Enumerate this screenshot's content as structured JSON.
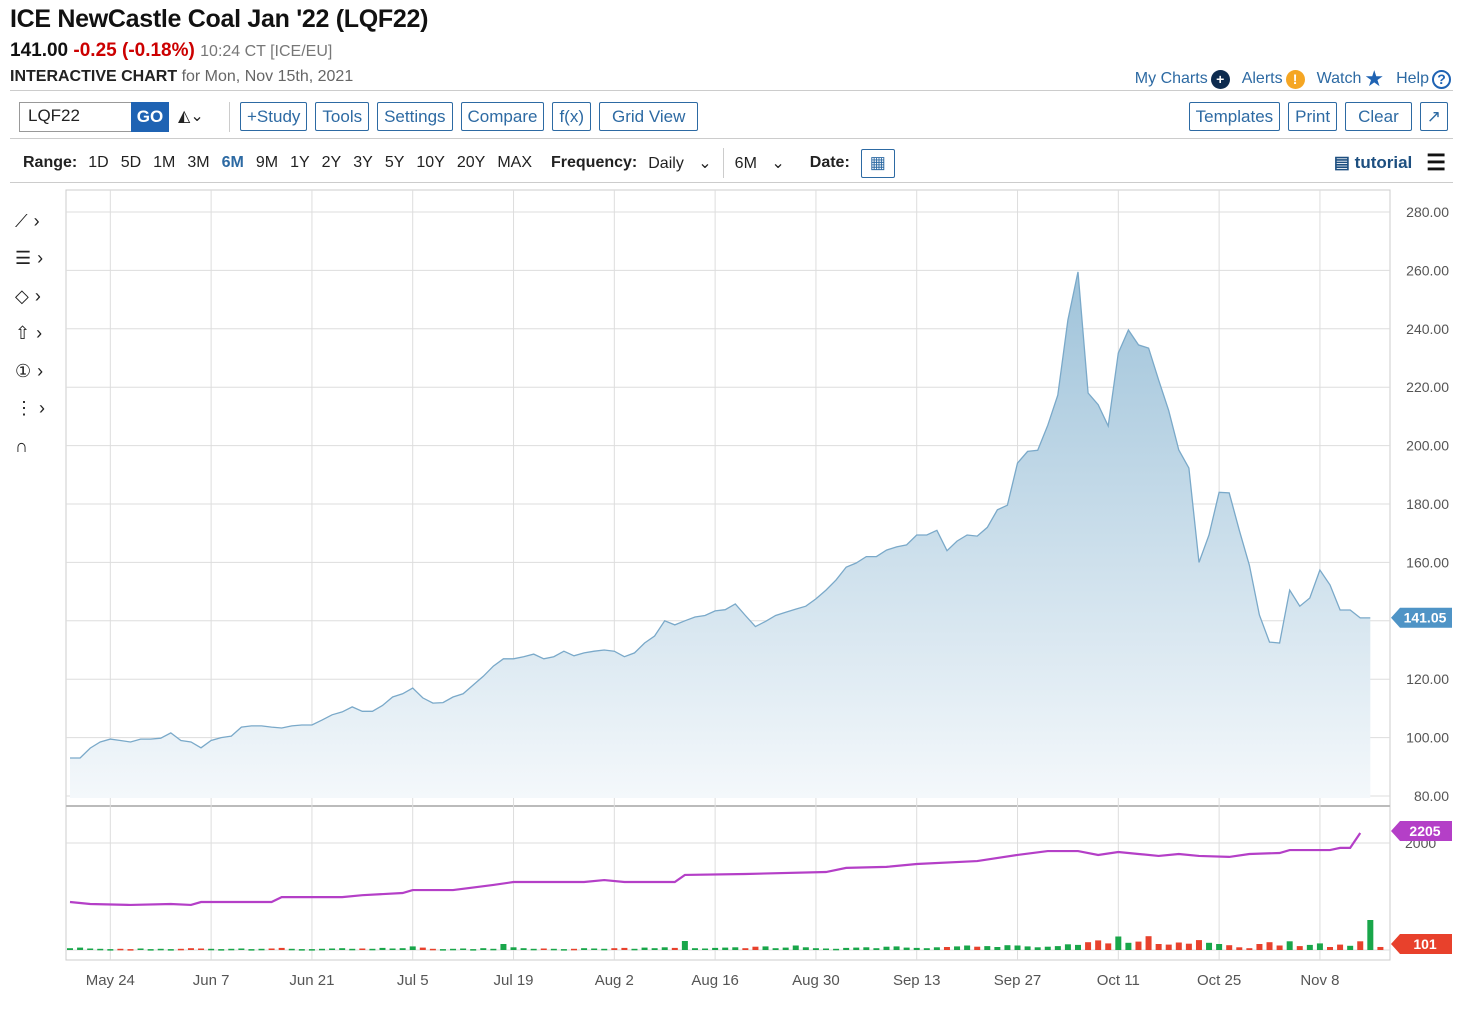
{
  "header": {
    "title": "ICE NewCastle Coal Jan '22 (LQF22)",
    "last": "141.00",
    "change": "-0.25 (-0.18%)",
    "time": "10:24 CT [ICE/EU]",
    "chart_label": "INTERACTIVE CHART",
    "chart_date": "for Mon, Nov 15th, 2021"
  },
  "links": {
    "my_charts": "My Charts",
    "alerts": "Alerts",
    "watch": "Watch",
    "help": "Help"
  },
  "toolbar": {
    "symbol": "LQF22",
    "go": "GO",
    "study": "+Study",
    "tools": "Tools",
    "settings": "Settings",
    "compare": "Compare",
    "fx": "f(x)",
    "grid": "Grid View",
    "templates": "Templates",
    "print": "Print",
    "clear": "Clear",
    "expand": "↗"
  },
  "range": {
    "label": "Range:",
    "options": [
      "1D",
      "5D",
      "1M",
      "3M",
      "6M",
      "9M",
      "1Y",
      "2Y",
      "3Y",
      "5Y",
      "10Y",
      "20Y",
      "MAX"
    ],
    "selected": "6M",
    "freq_label": "Frequency:",
    "frequency": "Daily",
    "period": "6M",
    "date_label": "Date:",
    "tutorial": "tutorial"
  },
  "chart_data": {
    "type": "area",
    "title": "ICE NewCastle Coal Jan '22 (LQF22)",
    "ylim": [
      80,
      280
    ],
    "y_ticks": [
      "80.00",
      "100.00",
      "120.00",
      "140.00",
      "160.00",
      "180.00",
      "200.00",
      "220.00",
      "240.00",
      "260.00",
      "280.00"
    ],
    "x_ticks": [
      {
        "label": "May 24",
        "index": 4
      },
      {
        "label": "Jun 7",
        "index": 14
      },
      {
        "label": "Jun 21",
        "index": 24
      },
      {
        "label": "Jul 5",
        "index": 34
      },
      {
        "label": "Jul 19",
        "index": 44
      },
      {
        "label": "Aug 2",
        "index": 54
      },
      {
        "label": "Aug 16",
        "index": 64
      },
      {
        "label": "Aug 30",
        "index": 74
      },
      {
        "label": "Sep 13",
        "index": 84
      },
      {
        "label": "Sep 27",
        "index": 94
      },
      {
        "label": "Oct 11",
        "index": 104
      },
      {
        "label": "Oct 25",
        "index": 114
      },
      {
        "label": "Nov 8",
        "index": 124
      }
    ],
    "price": [
      93,
      93,
      96.4,
      98.5,
      99.5,
      99,
      98.5,
      99.5,
      99.5,
      99.8,
      101.6,
      99,
      98.5,
      96.5,
      99,
      100,
      100.5,
      103.6,
      104,
      104,
      103.6,
      103.3,
      104,
      104.3,
      104.3,
      106,
      107.8,
      108.8,
      110.5,
      109,
      109,
      111,
      113.9,
      115,
      117,
      113.6,
      111.8,
      112,
      113.9,
      115,
      118,
      121,
      124.5,
      127,
      127,
      127.7,
      128.6,
      127,
      127.7,
      129.6,
      128,
      129,
      129.6,
      130,
      129.6,
      127.7,
      129,
      132.4,
      134.8,
      140,
      138.6,
      140,
      141.3,
      141.8,
      143.4,
      143.8,
      145.8,
      141.8,
      138,
      139.8,
      141.8,
      142.9,
      144,
      145,
      147.5,
      150.5,
      154,
      158.4,
      159.8,
      162,
      162,
      164.2,
      165.3,
      166,
      169.4,
      169.4,
      171,
      164,
      167.3,
      169.4,
      169,
      172,
      178,
      179.6,
      194,
      198,
      198.4,
      207,
      217.3,
      243,
      259.5,
      218,
      214,
      206.7,
      231.7,
      239.6,
      234.5,
      233.4,
      222.5,
      212,
      198.5,
      192.3,
      160,
      169.4,
      184,
      183.8,
      171,
      159,
      142,
      132.7,
      132.4,
      150.5,
      145,
      147.8,
      157.4,
      152.3,
      143.7,
      143.7,
      141,
      141
    ],
    "last_price_label": "141.05",
    "open_interest": [
      [
        0,
        790
      ],
      [
        2,
        750
      ],
      [
        6,
        730
      ],
      [
        10,
        750
      ],
      [
        12,
        730
      ],
      [
        13,
        790
      ],
      [
        20,
        790
      ],
      [
        21,
        890
      ],
      [
        27,
        890
      ],
      [
        29,
        930
      ],
      [
        33,
        975
      ],
      [
        34,
        1035
      ],
      [
        38,
        1035
      ],
      [
        42,
        1140
      ],
      [
        44,
        1200
      ],
      [
        51,
        1200
      ],
      [
        53,
        1240
      ],
      [
        55,
        1200
      ],
      [
        60,
        1200
      ],
      [
        61,
        1345
      ],
      [
        67,
        1365
      ],
      [
        75,
        1405
      ],
      [
        77,
        1490
      ],
      [
        81,
        1510
      ],
      [
        84,
        1570
      ],
      [
        90,
        1630
      ],
      [
        94,
        1755
      ],
      [
        97,
        1835
      ],
      [
        100,
        1835
      ],
      [
        102,
        1755
      ],
      [
        104,
        1815
      ],
      [
        106,
        1775
      ],
      [
        108,
        1735
      ],
      [
        110,
        1775
      ],
      [
        112,
        1735
      ],
      [
        115,
        1715
      ],
      [
        117,
        1775
      ],
      [
        120,
        1795
      ],
      [
        121,
        1855
      ],
      [
        125,
        1855
      ],
      [
        126,
        1900
      ],
      [
        127,
        1900
      ],
      [
        128,
        2205
      ]
    ],
    "oi_tick": "2000",
    "oi_label": "2205",
    "volume": [
      60,
      80,
      50,
      40,
      30,
      40,
      30,
      50,
      30,
      40,
      30,
      40,
      60,
      50,
      40,
      30,
      40,
      50,
      30,
      40,
      50,
      70,
      40,
      30,
      30,
      40,
      50,
      60,
      40,
      50,
      40,
      70,
      50,
      60,
      120,
      80,
      40,
      30,
      40,
      50,
      30,
      60,
      40,
      200,
      90,
      60,
      40,
      50,
      40,
      30,
      40,
      60,
      50,
      40,
      60,
      70,
      40,
      80,
      60,
      90,
      70,
      300,
      60,
      50,
      70,
      80,
      90,
      60,
      110,
      120,
      60,
      80,
      150,
      90,
      60,
      50,
      40,
      70,
      80,
      90,
      60,
      110,
      120,
      80,
      70,
      60,
      90,
      100,
      120,
      150,
      110,
      130,
      100,
      160,
      150,
      120,
      90,
      110,
      130,
      190,
      170,
      260,
      320,
      220,
      450,
      240,
      280,
      460,
      200,
      180,
      250,
      210,
      330,
      240,
      200,
      160,
      90,
      60,
      200,
      260,
      150,
      290,
      130,
      170,
      220,
      100,
      180,
      140,
      290,
      1000,
      101
    ],
    "volume_label": "101",
    "colors": {
      "area_line": "#7aa9c9",
      "area_fill_top": "#a7c8dd",
      "oi": "#b43fc7",
      "vol_up": "#19a64a",
      "vol_down": "#e8412c",
      "price_tag": "#4f94c6"
    }
  }
}
